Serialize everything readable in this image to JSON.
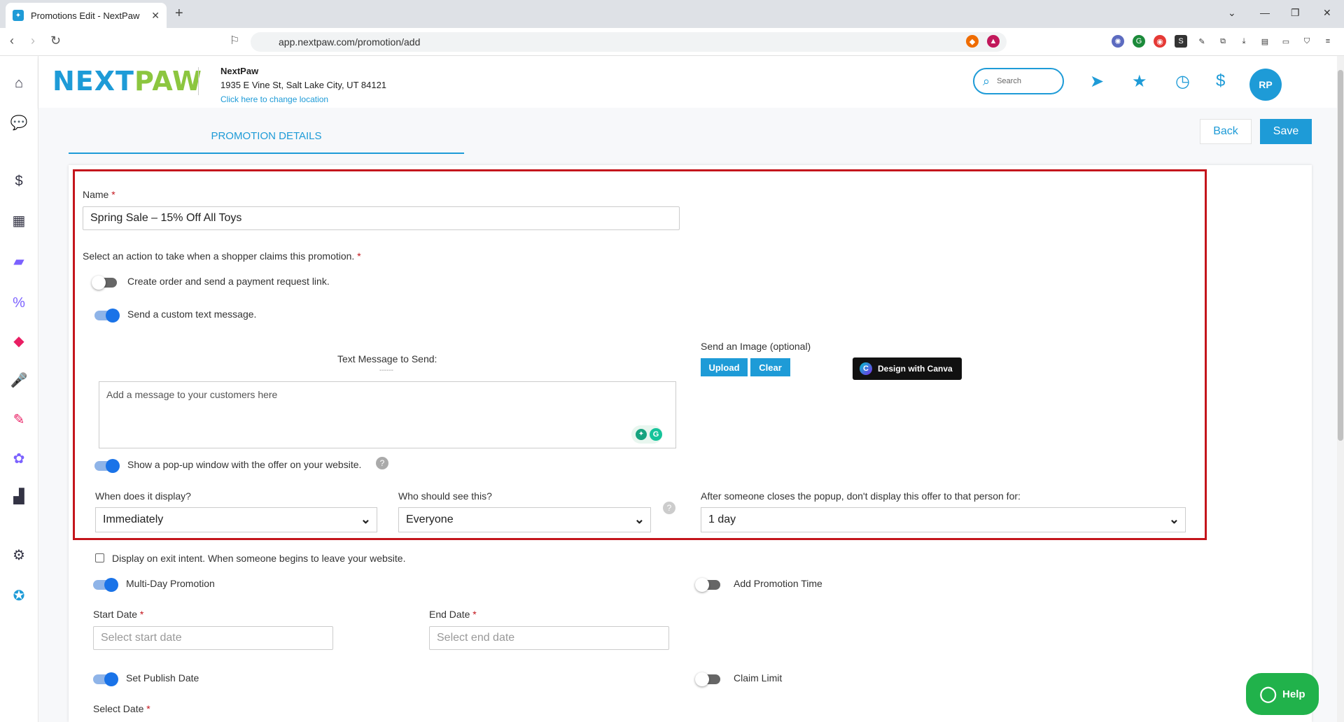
{
  "browser": {
    "tab_title": "Promotions Edit - NextPaw",
    "new_tab": "+",
    "url": "app.nextpaw.com/promotion/add"
  },
  "header": {
    "logo_part1": "NEXT",
    "logo_part2": "PAW",
    "business_name": "NextPaw",
    "address": "1935 E Vine St, Salt Lake City, UT 84121",
    "change_location": "Click here to change location",
    "search_placeholder": "Search",
    "avatar": "RP"
  },
  "page": {
    "tab": "PROMOTION DETAILS",
    "back": "Back",
    "save": "Save"
  },
  "form": {
    "name_label": "Name",
    "name_value": "Spring Sale – 15% Off All Toys",
    "action_label": "Select an action to take when a shopper claims this promotion.",
    "opt_order": "Create order and send a payment request link.",
    "opt_text": "Send a custom text message.",
    "text_msg_label": "Text Message to Send:",
    "text_msg_dash": "------",
    "message_placeholder": "Add a message to your customers here",
    "image_label": "Send an Image (optional)",
    "upload": "Upload",
    "clear": "Clear",
    "canva": "Design with Canva",
    "popup": "Show a pop-up window with the offer on your website.",
    "when_label": "When does it display?",
    "when_value": "Immediately",
    "who_label": "Who should see this?",
    "who_value": "Everyone",
    "after_label": "After someone closes the popup, don't display this offer to that person for:",
    "after_value": "1 day",
    "exit_intent": "Display on exit intent. When someone begins to leave your website.",
    "multi_day": "Multi-Day Promotion",
    "add_time": "Add Promotion Time",
    "start_label": "Start Date",
    "start_placeholder": "Select start date",
    "end_label": "End Date",
    "end_placeholder": "Select end date",
    "publish": "Set Publish Date",
    "claim_limit": "Claim Limit",
    "select_date": "Select Date",
    "required": "*"
  },
  "help": "Help",
  "colors": {
    "brand": "#1e9bd7",
    "brand_green": "#8cc63f",
    "highlight": "#c4151c",
    "help": "#21b24b"
  }
}
